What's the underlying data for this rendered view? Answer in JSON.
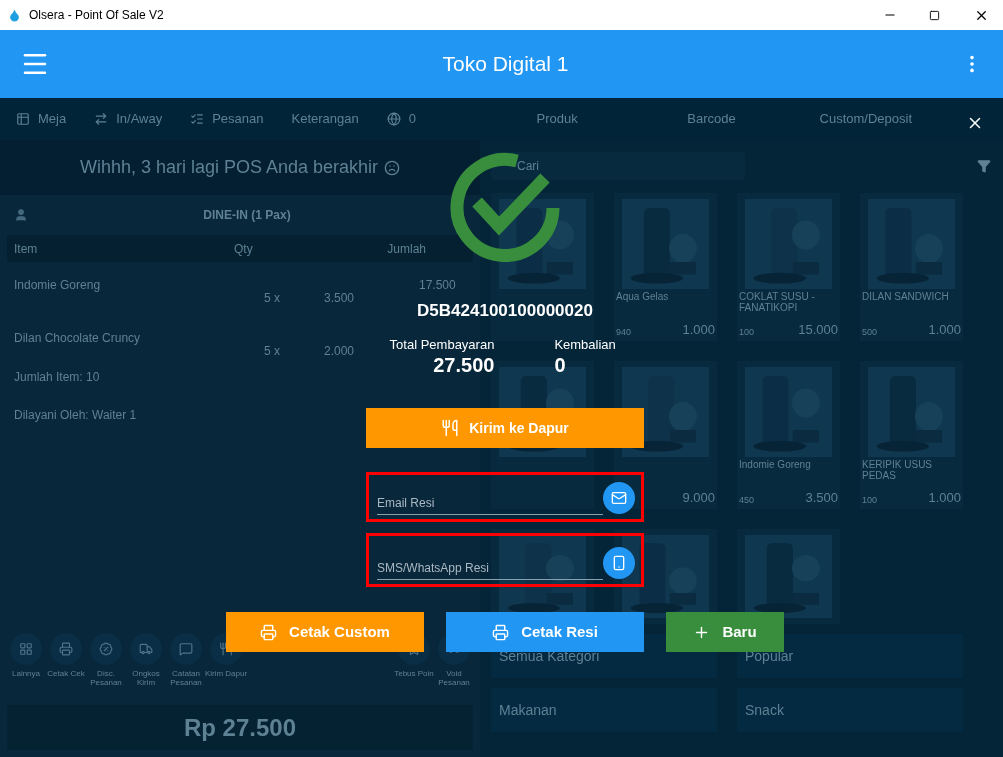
{
  "window": {
    "title": "Olsera - Point Of Sale V2"
  },
  "app_bar": {
    "title": "Toko Digital 1"
  },
  "tabs": [
    {
      "label": "Meja"
    },
    {
      "label": "In/Away"
    },
    {
      "label": "Pesanan"
    },
    {
      "label": "Keterangan"
    },
    {
      "label": "0"
    },
    {
      "label": "Produk"
    },
    {
      "label": "Barcode"
    },
    {
      "label": "Custom/Deposit"
    }
  ],
  "banner": "Wihhh, 3 hari lagi POS Anda berakhir",
  "order": {
    "type": "DINE-IN (1 Pax)",
    "columns": [
      "Item",
      "Qty",
      "Jumlah"
    ],
    "rows": [
      {
        "item": "Indomie Goreng",
        "qty": "5 x",
        "price": "3.500",
        "amount": "17.500"
      },
      {
        "item": "Dilan Chocolate Cruncy",
        "qty": "5 x",
        "price": "2.000"
      }
    ],
    "item_count": "Jumlah Item: 10",
    "served_by": "Dilayani Oleh: Waiter 1"
  },
  "actions": [
    {
      "label": "Lainnya"
    },
    {
      "label": "Cetak Cek"
    },
    {
      "label": "Disc. Pesanan"
    },
    {
      "label": "Ongkos Kirim"
    },
    {
      "label": "Catatan Pesanan"
    },
    {
      "label": "Kirim Dapur"
    },
    {
      "label": "Tebus Poin"
    },
    {
      "label": "Void Pesanan"
    }
  ],
  "total": "Rp 27.500",
  "search": {
    "placeholder": "Cari"
  },
  "products": [
    {
      "kind": "picture"
    },
    {
      "kind": "picture",
      "name": "Aqua Gelas",
      "stock": "940",
      "price": "1.000"
    },
    {
      "kind": "picture",
      "name": "COKLAT SUSU - FANATIKOPI",
      "stock": "100",
      "price": "15.000"
    },
    {
      "kind": "picture",
      "name": "DILAN SANDWICH",
      "stock": "500",
      "price": "1.000"
    },
    {
      "kind": "picture"
    },
    {
      "kind": "picture",
      "price": "9.000"
    },
    {
      "kind": "picture",
      "name": "Indomie Goreng",
      "stock": "450",
      "price": "3.500"
    },
    {
      "kind": "picture",
      "name": "KERIPIK USUS PEDAS",
      "stock": "100",
      "price": "1.000"
    },
    {
      "kind": "picture"
    },
    {
      "kind": "picture"
    },
    {
      "kind": "picture"
    }
  ],
  "categories": [
    "Semua Kategori",
    "Popular",
    "Makanan",
    "Snack"
  ],
  "modal": {
    "receipt_no": "D5B424100100000020",
    "total_label": "Total Pembayaran",
    "total": "27.500",
    "change_label": "Kembalian",
    "change": "0",
    "kitchen_button": "Kirim ke Dapur",
    "fields": [
      {
        "kind": "email",
        "placeholder": "Email Resi",
        "highlighted": true
      },
      {
        "kind": "phone",
        "placeholder": "SMS/WhatsApp Resi",
        "highlighted": true
      }
    ],
    "buttons": [
      {
        "kind": "custom",
        "label": "Cetak Custom"
      },
      {
        "kind": "print",
        "label": "Cetak Resi"
      },
      {
        "kind": "new",
        "label": "Baru"
      }
    ]
  }
}
